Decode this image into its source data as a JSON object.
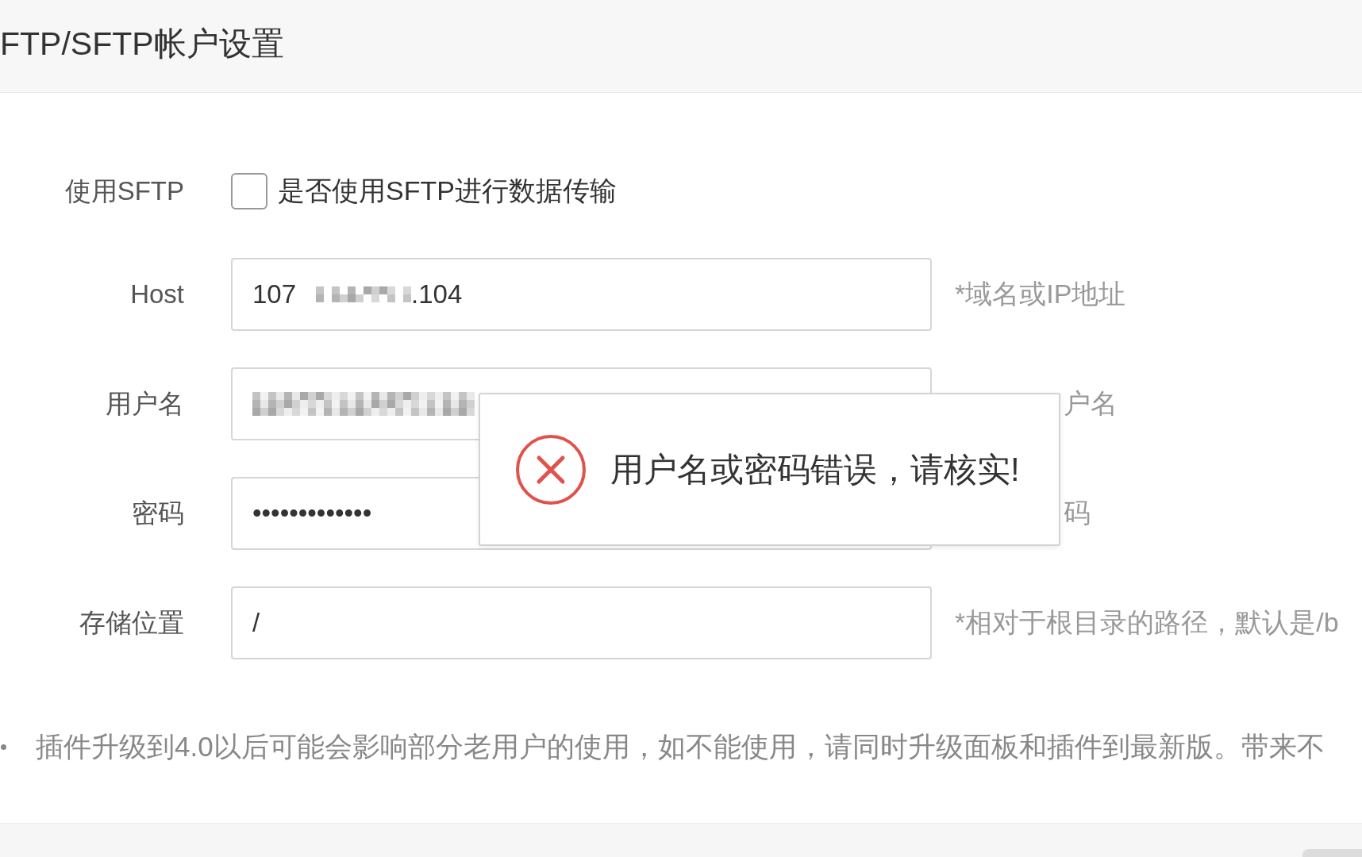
{
  "header": {
    "title": "FTP/SFTP帐户设置"
  },
  "sftp": {
    "label": "使用SFTP",
    "checked": false,
    "text": "是否使用SFTP进行数据传输"
  },
  "fields": [
    {
      "label": "Host",
      "kind": "partly_redacted",
      "value_start": "107",
      "value_end": ".104",
      "hint": "*域名或IP地址"
    },
    {
      "label": "用户名",
      "kind": "redacted",
      "hint": "户名"
    },
    {
      "label": "密码",
      "kind": "text",
      "value": "•••••••••••••",
      "hint": "码"
    },
    {
      "label": "存储位置",
      "kind": "text",
      "value": "/",
      "hint": "*相对于根目录的路径，默认是/b"
    }
  ],
  "notes": [
    "插件升级到4.0以后可能会影响部分老用户的使用，如不能使用，请同时升级面板和插件到最新版。带来不"
  ],
  "toast": {
    "kind": "error",
    "message": "用户名或密码错误，请核实!"
  }
}
